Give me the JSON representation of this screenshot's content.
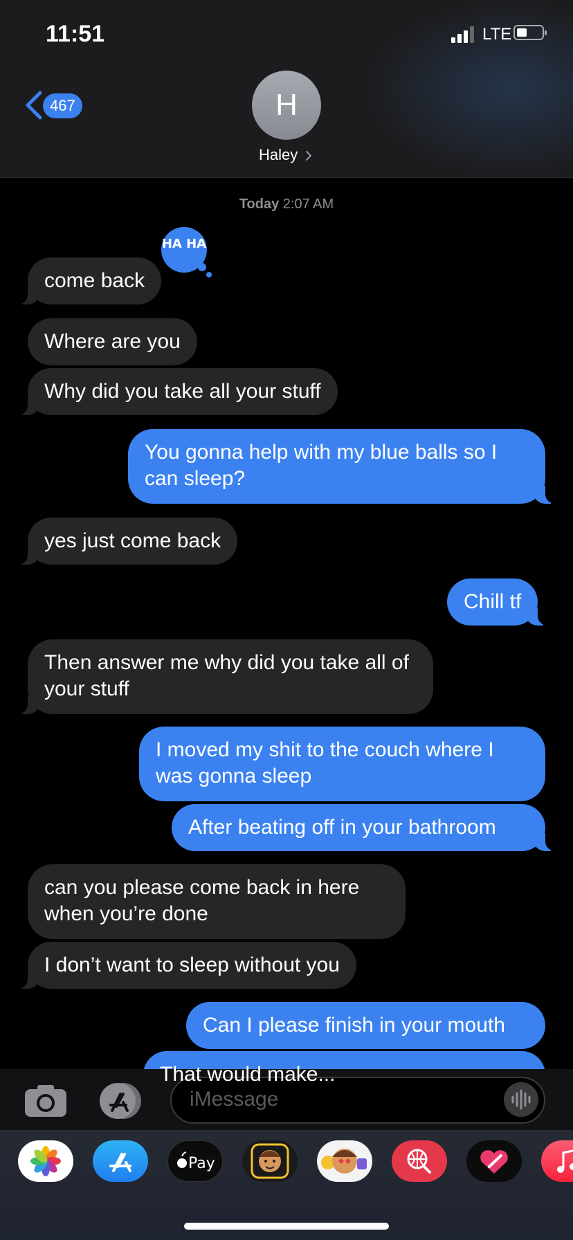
{
  "status": {
    "time": "11:51",
    "network": "LTE"
  },
  "header": {
    "back_count": "467",
    "avatar_initial": "H",
    "contact_name": "Haley"
  },
  "thread": {
    "timestamp_prefix": "Today",
    "timestamp_time": "2:07 AM",
    "tapback": "HA HA",
    "messages": [
      {
        "from": "them",
        "text": "come back"
      },
      {
        "from": "them",
        "text": "Where are you"
      },
      {
        "from": "them",
        "text": "Why did you take all your stuff"
      },
      {
        "from": "me",
        "text": "You gonna help with my blue balls so I can sleep?"
      },
      {
        "from": "them",
        "text": "yes just come back"
      },
      {
        "from": "me",
        "text": "Chill tf"
      },
      {
        "from": "them",
        "text": "Then answer me why did you take all of your stuff"
      },
      {
        "from": "me",
        "text": "I moved my shit to the couch where I was gonna sleep"
      },
      {
        "from": "me",
        "text": "After beating off in your bathroom"
      },
      {
        "from": "them",
        "text": "can you please come back in here when you’re done"
      },
      {
        "from": "them",
        "text": "I don’t want to sleep without you"
      },
      {
        "from": "me",
        "text": "Can I please finish in your mouth"
      },
      {
        "from": "me",
        "text": "That would make..."
      }
    ]
  },
  "compose": {
    "placeholder": "iMessage"
  },
  "app_drawer": {
    "apps": [
      {
        "icon": "photos-icon",
        "label": ""
      },
      {
        "icon": "app-store-icon",
        "label": ""
      },
      {
        "icon": "apple-pay-icon",
        "label": "Pay"
      },
      {
        "icon": "memoji-icon",
        "label": ""
      },
      {
        "icon": "memoji-stickers-icon",
        "label": ""
      },
      {
        "icon": "image-search-icon",
        "label": ""
      },
      {
        "icon": "digital-touch-icon",
        "label": ""
      },
      {
        "icon": "music-icon",
        "label": ""
      }
    ]
  },
  "colors": {
    "outgoing": "#3b82f0",
    "incoming": "#262628",
    "accent": "#3b82f0"
  }
}
